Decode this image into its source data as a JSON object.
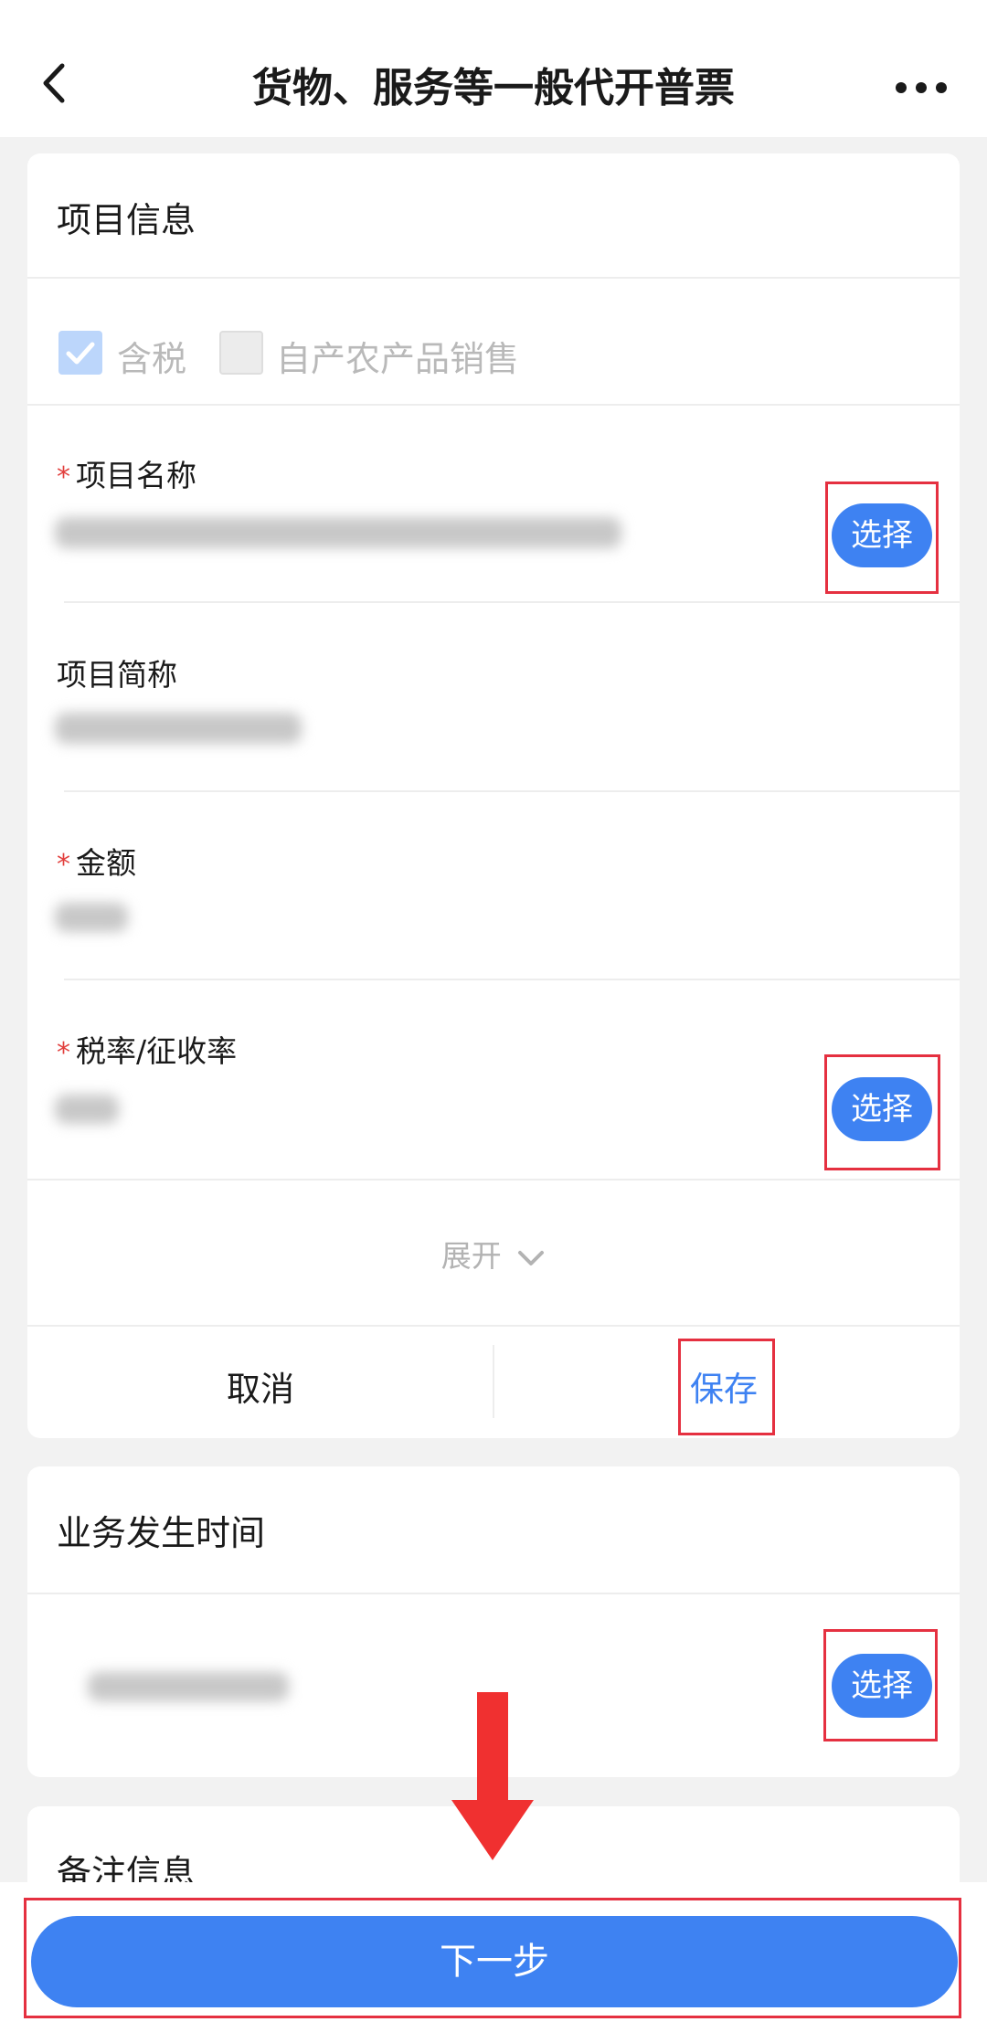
{
  "header": {
    "title": "货物、服务等一般代开普票",
    "back_icon": "chevron-left-icon",
    "more_icon": "more-dots-icon"
  },
  "item_info": {
    "section_title": "项目信息",
    "tax_included": {
      "label": "含税",
      "checked": true
    },
    "self_produced": {
      "label": "自产农产品销售",
      "checked": false
    },
    "item_name": {
      "label": "项目名称",
      "required": true,
      "select_label": "选择"
    },
    "item_short": {
      "label": "项目简称"
    },
    "amount": {
      "label": "金额",
      "required": true
    },
    "tax_rate": {
      "label": "税率/征收率",
      "required": true,
      "select_label": "选择"
    },
    "expand_label": "展开",
    "cancel_label": "取消",
    "save_label": "保存"
  },
  "business_time": {
    "section_title": "业务发生时间",
    "select_label": "选择"
  },
  "remark": {
    "section_title": "备注信息"
  },
  "footer": {
    "next_label": "下一步"
  },
  "colors": {
    "accent": "#3e82f2",
    "highlight_box": "#e53040",
    "required_mark": "#e2403e"
  }
}
